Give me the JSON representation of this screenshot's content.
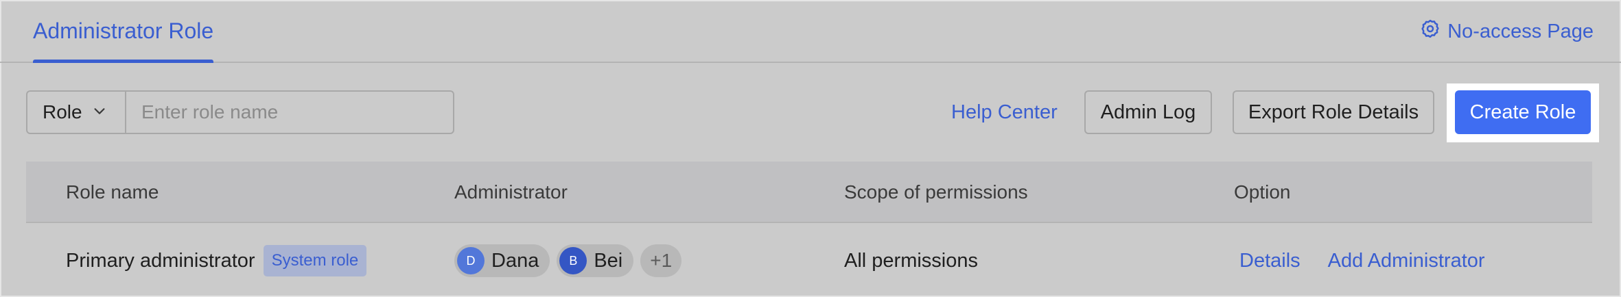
{
  "header": {
    "active_tab": "Administrator Role",
    "no_access_label": "No-access Page"
  },
  "toolbar": {
    "filter_select": "Role",
    "search_placeholder": "Enter role name",
    "help_link": "Help Center",
    "admin_log_label": "Admin Log",
    "export_label": "Export Role Details",
    "create_label": "Create Role"
  },
  "table": {
    "columns": [
      "Role name",
      "Administrator",
      "Scope of permissions",
      "Option"
    ],
    "rows": [
      {
        "role_name": "Primary administrator",
        "badge": "System role",
        "admins": [
          {
            "initial": "D",
            "name": "Dana"
          },
          {
            "initial": "B",
            "name": "Bei"
          }
        ],
        "more_count": "+1",
        "scope": "All permissions",
        "options": [
          "Details",
          "Add Administrator"
        ]
      }
    ]
  },
  "colors": {
    "accent": "#3a5ed0",
    "primary_button": "#3f6df2",
    "background": "#cbcbcb"
  }
}
